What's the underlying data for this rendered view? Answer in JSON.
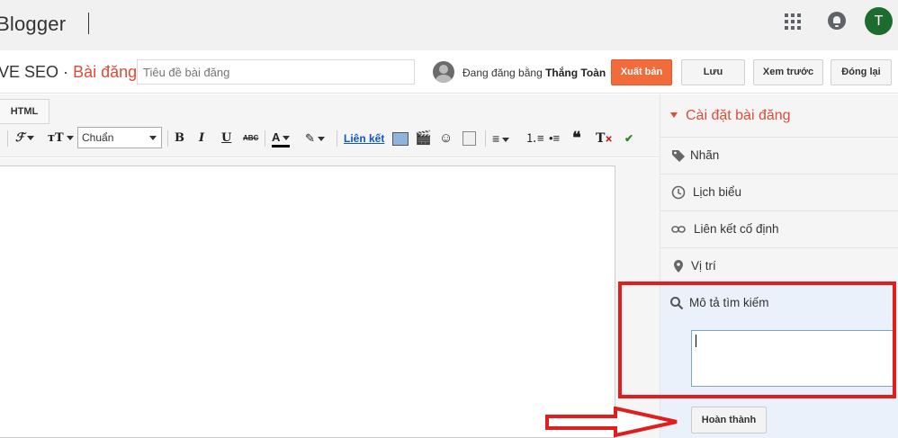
{
  "app": {
    "logo": "Blogger",
    "avatar_letter": "T"
  },
  "header": {
    "blog_name": "VE SEO",
    "separator": "·",
    "section": "Bài đăng",
    "title_placeholder": "Tiêu đề bài đăng",
    "posting_as_prefix": "Đang đăng bằng",
    "posting_as_user": "Thắng Toàn",
    "publish_label": "Xuất bản",
    "save_label": "Lưu",
    "preview_label": "Xem trước",
    "close_label": "Đóng lại"
  },
  "toolbar": {
    "html_tab": "HTML",
    "font_size_label": "Chuẩn",
    "bold": "B",
    "italic": "I",
    "underline": "U",
    "strike": "ABC",
    "link_label": "Liên kết"
  },
  "sidebar": {
    "title": "Cài đặt bài đăng",
    "items": [
      {
        "label": "Nhãn",
        "icon": "tag-icon"
      },
      {
        "label": "Lịch biểu",
        "icon": "clock-icon"
      },
      {
        "label": "Liên kết cố định",
        "icon": "link-icon"
      },
      {
        "label": "Vị trí",
        "icon": "location-pin-icon"
      }
    ],
    "search_description": {
      "label": "Mô tả tìm kiếm",
      "value": "",
      "done_label": "Hoàn thành"
    }
  },
  "colors": {
    "accent": "#dd4b39",
    "publish": "#f26b3a",
    "highlight": "#e01e1e",
    "avatar": "#1e6b2f"
  }
}
